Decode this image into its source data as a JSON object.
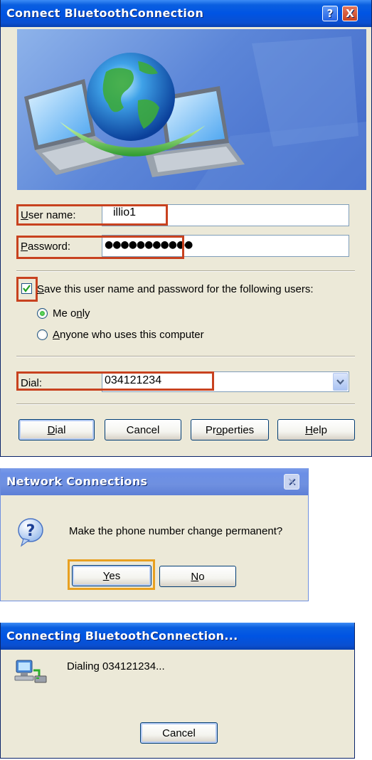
{
  "connect_dialog": {
    "title": "Connect BluetoothConnection",
    "help_button": "?",
    "close_button": "X",
    "username_label_u": "U",
    "username_label_rest": "ser name:",
    "username_value": "illio1",
    "password_label_u": "P",
    "password_label_rest": "assword:",
    "password_value": "●●●●●●●●●●●",
    "save_checked": true,
    "save_label_u": "S",
    "save_label_rest": "ave this user name and password for the following users:",
    "radio_me_pre": "Me o",
    "radio_me_u": "n",
    "radio_me_post": "ly",
    "radio_me_selected": true,
    "radio_anyone_u": "A",
    "radio_anyone_rest": "nyone who uses this computer",
    "dial_label": "Dial:",
    "dial_value": "034121234",
    "buttons": {
      "dial_u": "D",
      "dial_rest": "ial",
      "cancel": "Cancel",
      "properties_pre": "Pr",
      "properties_u": "o",
      "properties_post": "perties",
      "help_u": "H",
      "help_rest": "elp"
    }
  },
  "network_dialog": {
    "title": "Network Connections",
    "message": "Make the phone number change permanent?",
    "yes_u": "Y",
    "yes_rest": "es",
    "no_u": "N",
    "no_rest": "o"
  },
  "connecting_dialog": {
    "title": "Connecting BluetoothConnection...",
    "status": "Dialing 034121234...",
    "cancel": "Cancel"
  },
  "colors": {
    "highlight_red": "#c8421f",
    "highlight_orange": "#e8a020",
    "dialog_bg": "#ece9d8",
    "titlebar_blue": "#0054e3"
  }
}
